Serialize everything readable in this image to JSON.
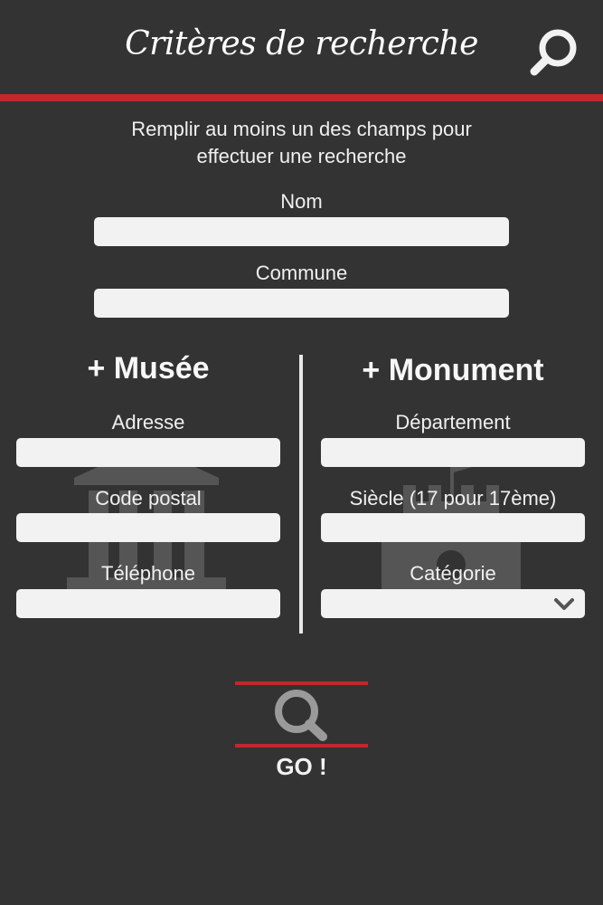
{
  "header": {
    "title": "Critères de recherche"
  },
  "intro": {
    "line1": "Remplir au moins un des champs pour",
    "line2": "effectuer une recherche"
  },
  "common": {
    "nom_label": "Nom",
    "nom_value": "",
    "commune_label": "Commune",
    "commune_value": ""
  },
  "musee": {
    "title": "+ Musée",
    "adresse_label": "Adresse",
    "code_postal_label": "Code postal",
    "telephone_label": "Téléphone"
  },
  "monument": {
    "title": "+ Monument",
    "departement_label": "Département",
    "siecle_label": "Siècle (17 pour 17ème)",
    "categorie_label": "Catégorie",
    "categorie_selected": ""
  },
  "go": {
    "label": "GO !"
  },
  "colors": {
    "background": "#333333",
    "accent": "#c1272d",
    "field": "#f2f2f2",
    "icon_gray": "#9a9a9a"
  },
  "icons": {
    "header": "search-icon",
    "go": "search-icon",
    "musee_background": "museum-icon",
    "monument_background": "castle-icon",
    "select": "chevron-down-icon"
  }
}
